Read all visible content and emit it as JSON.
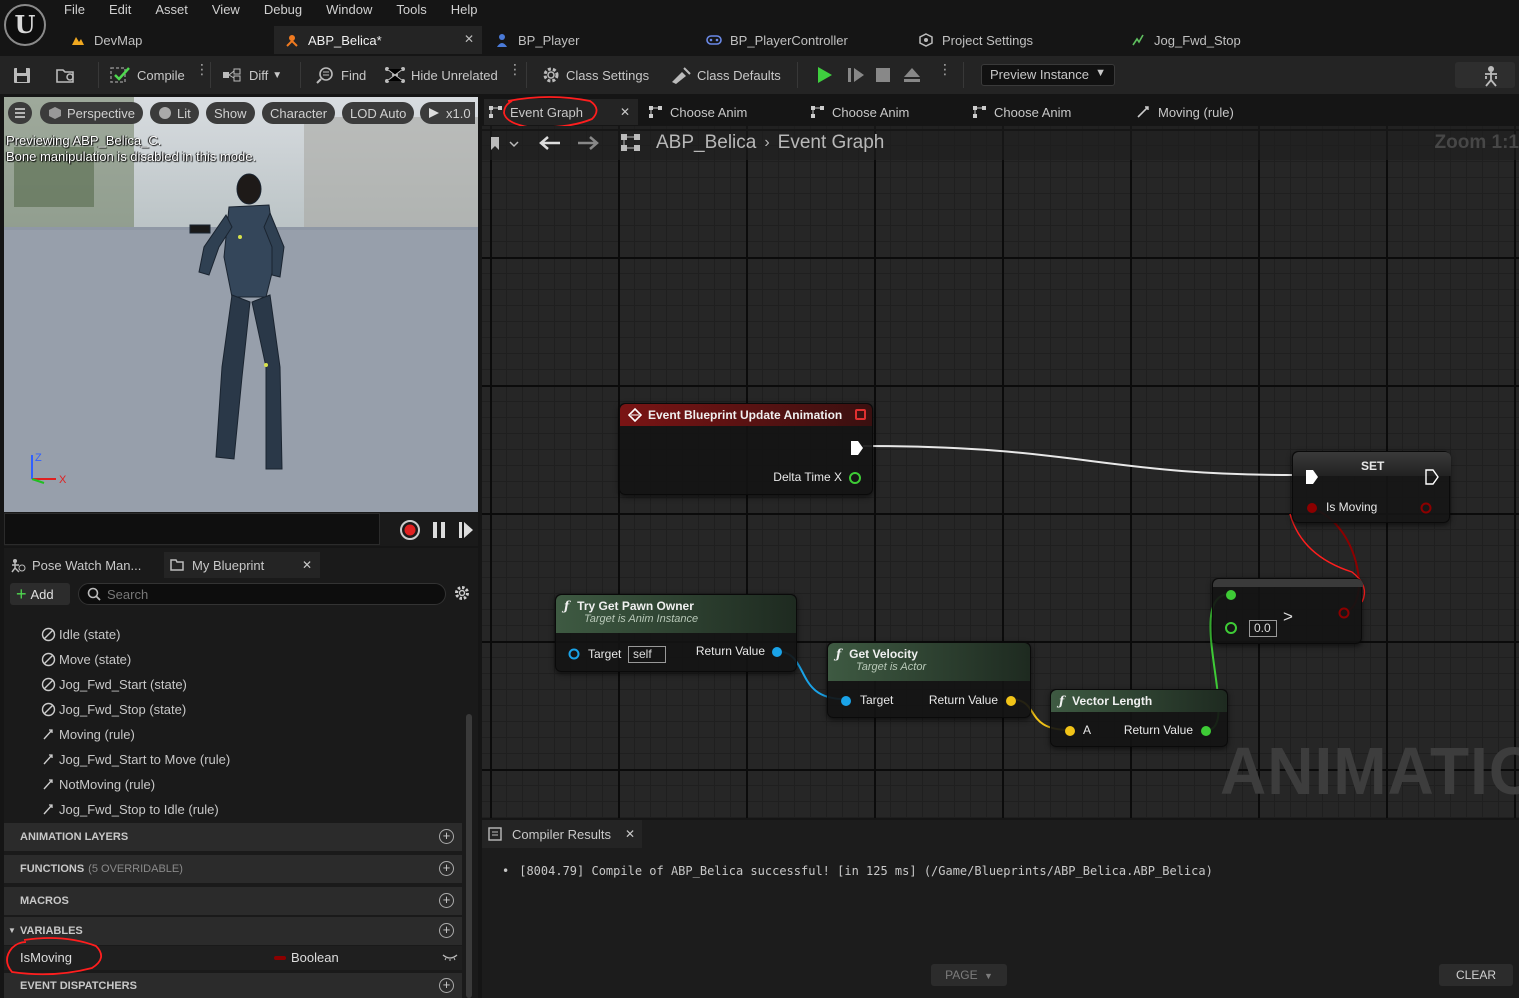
{
  "menu": [
    "File",
    "Edit",
    "Asset",
    "View",
    "Debug",
    "Window",
    "Tools",
    "Help"
  ],
  "asset_tabs": [
    {
      "label": "DevMap",
      "icon": "map-icon"
    },
    {
      "label": "ABP_Belica*",
      "icon": "anim-blueprint-icon"
    },
    {
      "label": "BP_Player",
      "icon": "person-icon"
    },
    {
      "label": "BP_PlayerController",
      "icon": "gamepad-icon"
    },
    {
      "label": "Project Settings",
      "icon": "settings-icon"
    },
    {
      "label": "Jog_Fwd_Stop",
      "icon": "animation-icon"
    }
  ],
  "toolbar": {
    "compile": "Compile",
    "diff": "Diff",
    "find": "Find",
    "hide_unrelated": "Hide Unrelated",
    "class_settings": "Class Settings",
    "class_defaults": "Class Defaults",
    "preview_instance": "Preview Instance"
  },
  "viewport": {
    "perspective": "Perspective",
    "lit": "Lit",
    "show": "Show",
    "character": "Character",
    "lod": "LOD Auto",
    "speed": "x1.0",
    "overlay_line1": "Previewing ABP_Belica_C.",
    "overlay_line2": "Bone manipulation is disabled in this mode.",
    "axis_z": "Z",
    "axis_x": "X"
  },
  "left_panel": {
    "tab_pose_watch": "Pose Watch Man...",
    "tab_my_blueprint": "My Blueprint",
    "add": "Add",
    "search_placeholder": "Search",
    "tree": [
      {
        "label": "Idle (state)",
        "icon": "state-icon"
      },
      {
        "label": "Move (state)",
        "icon": "state-icon"
      },
      {
        "label": "Jog_Fwd_Start (state)",
        "icon": "state-icon"
      },
      {
        "label": "Jog_Fwd_Stop (state)",
        "icon": "state-icon"
      },
      {
        "label": "Moving (rule)",
        "icon": "rule-icon"
      },
      {
        "label": "Jog_Fwd_Start to Move (rule)",
        "icon": "rule-icon"
      },
      {
        "label": "NotMoving (rule)",
        "icon": "rule-icon"
      },
      {
        "label": "Jog_Fwd_Stop to Idle (rule)",
        "icon": "rule-icon"
      }
    ],
    "sections": {
      "animation_layers": "ANIMATION LAYERS",
      "functions": "FUNCTIONS",
      "functions_count": "(5 OVERRIDABLE)",
      "macros": "MACROS",
      "variables": "VARIABLES",
      "event_dispatchers": "EVENT DISPATCHERS"
    },
    "variable": {
      "name": "IsMoving",
      "type": "Boolean",
      "type_color": "#8c0000"
    }
  },
  "graph_tabs": [
    {
      "label": "Event Graph",
      "icon": "graph-icon"
    },
    {
      "label": "Choose Anim",
      "icon": "graph-icon"
    },
    {
      "label": "Choose Anim",
      "icon": "graph-icon"
    },
    {
      "label": "Choose Anim",
      "icon": "graph-icon"
    },
    {
      "label": "Moving (rule)",
      "icon": "rule-icon"
    }
  ],
  "graph": {
    "breadcrumb_root": "ABP_Belica",
    "breadcrumb_leaf": "Event Graph",
    "zoom": "Zoom 1:1",
    "watermark": "ANIMATION",
    "nodes": {
      "event": {
        "title": "Event Blueprint Update Animation",
        "pin_delta": "Delta Time X"
      },
      "set": {
        "title": "SET",
        "pin": "Is Moving"
      },
      "compare": {
        "value": "0.0",
        "op": ">"
      },
      "pawn_owner": {
        "title": "Try Get Pawn Owner",
        "subtitle": "Target is Anim Instance",
        "target": "Target",
        "self": "self",
        "ret": "Return Value"
      },
      "velocity": {
        "title": "Get Velocity",
        "subtitle": "Target is Actor",
        "target": "Target",
        "ret": "Return Value"
      },
      "vector_length": {
        "title": "Vector Length",
        "a": "A",
        "ret": "Return Value"
      }
    }
  },
  "compiler": {
    "tab": "Compiler Results",
    "message": "[8004.79] Compile of ABP_Belica successful! [in 125 ms] (/Game/Blueprints/ABP_Belica.ABP_Belica)",
    "page": "PAGE",
    "clear": "CLEAR"
  },
  "colors": {
    "event_header": "#7a1414",
    "function_header": "#3e5a42",
    "exec": "#ffffff",
    "bool_pin": "#8c0000",
    "object_pin": "#1aa3e8",
    "vector_pin": "#f2c418",
    "float_pin": "#3ecb36",
    "annotation": "#ff1e1e"
  }
}
